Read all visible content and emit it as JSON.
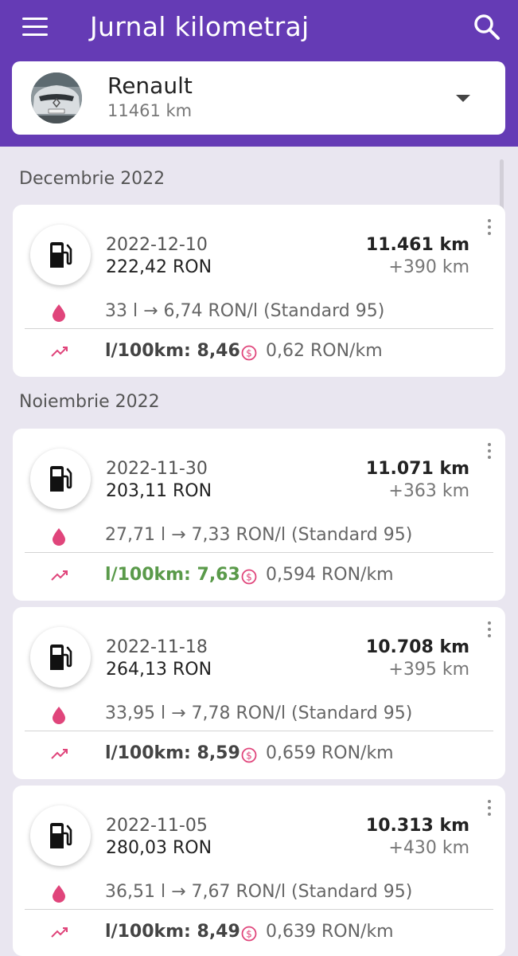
{
  "app": {
    "title": "Jurnal kilometraj"
  },
  "vehicle": {
    "name": "Renault",
    "odometer": "11461 km"
  },
  "colors": {
    "primary": "#653bb5",
    "accent": "#e0457b",
    "good": "#5a9a4a"
  },
  "icons": {
    "menu": "menu-icon",
    "search": "search-icon",
    "dropdown": "arrow-drop-down-icon",
    "fuel": "gas-station-icon",
    "drop": "water-drop-icon",
    "trend": "trending-up-icon",
    "cost": "dollar-coin-icon",
    "more": "more-vert-icon"
  },
  "months": [
    {
      "label": "Decembrie 2022"
    },
    {
      "label": "Noiembrie 2022"
    }
  ],
  "entries": [
    {
      "date": "2022-12-10",
      "cost": "222,42 RON",
      "odometer": "11.461 km",
      "delta": "+390 km",
      "fuel": "33 l  →  6,74 RON/l (Standard 95)",
      "consumption": "l/100km: 8,46",
      "cost_per_km": "0,62 RON/km"
    },
    {
      "date": "2022-11-30",
      "cost": "203,11 RON",
      "odometer": "11.071 km",
      "delta": "+363 km",
      "fuel": "27,71 l  →  7,33 RON/l (Standard 95)",
      "consumption": "l/100km: 7,63",
      "cost_per_km": "0,594 RON/km"
    },
    {
      "date": "2022-11-18",
      "cost": "264,13 RON",
      "odometer": "10.708 km",
      "delta": "+395 km",
      "fuel": "33,95 l  →  7,78 RON/l (Standard 95)",
      "consumption": "l/100km: 8,59",
      "cost_per_km": "0,659 RON/km"
    },
    {
      "date": "2022-11-05",
      "cost": "280,03 RON",
      "odometer": "10.313 km",
      "delta": "+430 km",
      "fuel": "36,51 l  →  7,67 RON/l (Standard 95)",
      "consumption": "l/100km: 8,49",
      "cost_per_km": "0,639 RON/km"
    }
  ]
}
